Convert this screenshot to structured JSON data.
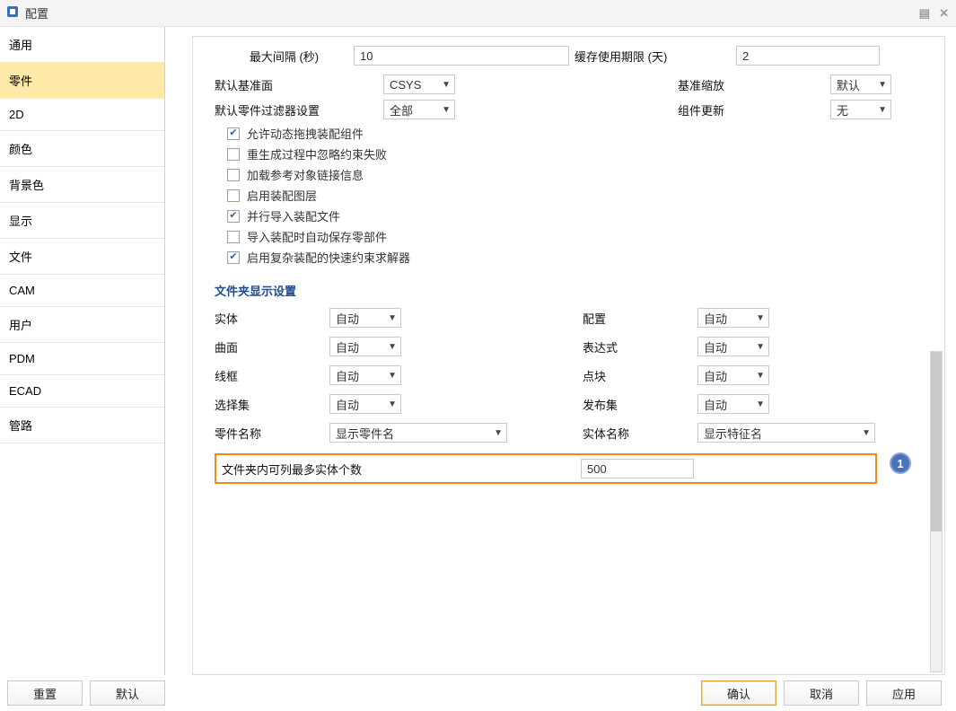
{
  "title": "配置",
  "sidebar": [
    "通用",
    "零件",
    "2D",
    "颜色",
    "背景色",
    "显示",
    "文件",
    "CAM",
    "用户",
    "PDM",
    "ECAD",
    "管路"
  ],
  "sidebar_selected_index": 1,
  "top_row": {
    "max_interval_label": "最大间隔 (秒)",
    "max_interval_value": "10",
    "cache_label": "缓存使用期限 (天)",
    "cache_value": "2"
  },
  "row2": {
    "default_datum_label": "默认基准面",
    "default_datum_value": "CSYS",
    "datum_scale_label": "基准缩放",
    "datum_scale_value": "默认"
  },
  "row3": {
    "filter_label": "默认零件过滤器设置",
    "filter_value": "全部",
    "update_label": "组件更新",
    "update_value": "无"
  },
  "checks": [
    {
      "text": "允许动态拖拽装配组件",
      "on": true
    },
    {
      "text": "重生成过程中忽略约束失败",
      "on": false
    },
    {
      "text": "加载参考对象链接信息",
      "on": false
    },
    {
      "text": "启用装配图层",
      "on": false
    },
    {
      "text": "并行导入装配文件",
      "on": true
    },
    {
      "text": "导入装配时自动保存零部件",
      "on": false
    },
    {
      "text": "启用复杂装配的快速约束求解器",
      "on": true
    }
  ],
  "folder_section_title": "文件夹显示设置",
  "folder": {
    "labels": {
      "solid": "实体",
      "config": "配置",
      "surface": "曲面",
      "expr": "表达式",
      "wire": "线框",
      "block": "点块",
      "selset": "选择集",
      "pubset": "发布集",
      "partname": "零件名称",
      "solidname": "实体名称"
    },
    "values": {
      "solid": "自动",
      "config": "自动",
      "surface": "自动",
      "expr": "自动",
      "wire": "自动",
      "block": "自动",
      "selset": "自动",
      "pubset": "自动",
      "partname": "显示零件名",
      "solidname": "显示特征名"
    }
  },
  "highlight": {
    "label": "文件夹内可列最多实体个数",
    "value": "500",
    "callout": "1"
  },
  "footer": {
    "reset": "重置",
    "default": "默认",
    "ok": "确认",
    "cancel": "取消",
    "apply": "应用"
  }
}
